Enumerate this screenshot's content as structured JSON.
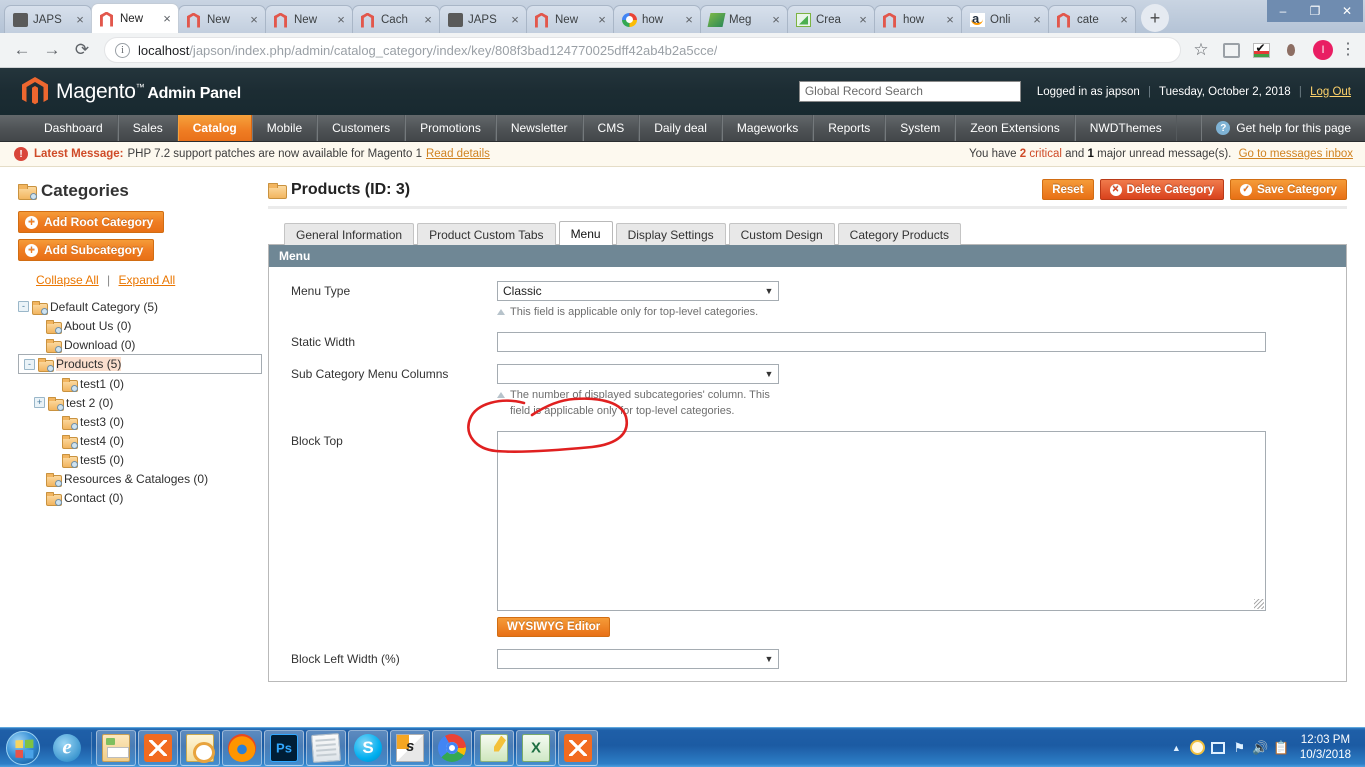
{
  "browser": {
    "tabs": [
      {
        "title": "JAPS",
        "favicon": "japs-icon",
        "active": false
      },
      {
        "title": "New",
        "favicon": "magento-icon",
        "active": true
      },
      {
        "title": "New",
        "favicon": "magento-icon",
        "active": false
      },
      {
        "title": "New",
        "favicon": "magento-icon",
        "active": false
      },
      {
        "title": "Cach",
        "favicon": "magento-icon",
        "active": false
      },
      {
        "title": "JAPS",
        "favicon": "japs-icon",
        "active": false
      },
      {
        "title": "New",
        "favicon": "magento-icon",
        "active": false
      },
      {
        "title": "how",
        "favicon": "google-icon",
        "active": false
      },
      {
        "title": "Meg",
        "favicon": "mega-icon",
        "active": false
      },
      {
        "title": "Crea",
        "favicon": "create-icon",
        "active": false
      },
      {
        "title": "how",
        "favicon": "magento-icon",
        "active": false
      },
      {
        "title": "Onli",
        "favicon": "amazon-icon",
        "active": false
      },
      {
        "title": "cate",
        "favicon": "magento-icon",
        "active": false
      }
    ],
    "new_tab_label": "+",
    "close_label": "×",
    "window_controls": {
      "minimize": "–",
      "maximize": "❐",
      "close": "✕"
    },
    "nav": {
      "back": "←",
      "forward": "→",
      "reload": "⟳"
    },
    "omnibox": {
      "info_icon": "i",
      "url_host": "localhost",
      "url_path": "/japson/index.php/admin/catalog_category/index/key/808f3bad124770025dff42ab4b2a5cce/"
    },
    "toolbar_right": {
      "bookmark_icon": "☆",
      "avatar_letter": "I",
      "menu_icon": "⋮"
    }
  },
  "magento": {
    "logo_text": "Magento",
    "logo_tm": "™",
    "logo_suffix": "Admin Panel",
    "search_placeholder": "Global Record Search",
    "logged_in_as": "Logged in as japson",
    "date": "Tuesday, October 2, 2018",
    "logout": "Log Out",
    "nav_items": [
      {
        "label": "Dashboard",
        "active": false
      },
      {
        "label": "Sales",
        "active": false
      },
      {
        "label": "Catalog",
        "active": true
      },
      {
        "label": "Mobile",
        "active": false
      },
      {
        "label": "Customers",
        "active": false
      },
      {
        "label": "Promotions",
        "active": false
      },
      {
        "label": "Newsletter",
        "active": false
      },
      {
        "label": "CMS",
        "active": false
      },
      {
        "label": "Daily deal",
        "active": false
      },
      {
        "label": "Mageworks",
        "active": false
      },
      {
        "label": "Reports",
        "active": false
      },
      {
        "label": "System",
        "active": false
      },
      {
        "label": "Zeon Extensions",
        "active": false
      },
      {
        "label": "NWDThemes",
        "active": false
      }
    ],
    "help_label": "Get help for this page",
    "help_icon_char": "?",
    "message_bar": {
      "icon_char": "!",
      "label": "Latest Message:",
      "text": "PHP 7.2 support patches are now available for Magento 1",
      "link": "Read details",
      "right_prefix": "You have",
      "right_critical_count": "2",
      "right_critical_word": "critical",
      "right_mid": "and",
      "right_major_count": "1",
      "right_suffix": "major unread message(s).",
      "right_link": "Go to messages inbox"
    }
  },
  "sidebar": {
    "title": "Categories",
    "add_root_label": "Add Root Category",
    "add_sub_label": "Add Subcategory",
    "plus_char": "+",
    "collapse_all": "Collapse All",
    "expand_all": "Expand All",
    "separator": "|",
    "tree": [
      {
        "label": "Default Category (5)",
        "level": 0,
        "toggle": "-",
        "selected": false
      },
      {
        "label": "About Us (0)",
        "level": 1,
        "toggle": "",
        "selected": false
      },
      {
        "label": "Download (0)",
        "level": 1,
        "toggle": "",
        "selected": false
      },
      {
        "label": "Products (5)",
        "level": 1,
        "toggle": "-",
        "selected": true
      },
      {
        "label": "test1 (0)",
        "level": 2,
        "toggle": "",
        "selected": false
      },
      {
        "label": "test 2 (0)",
        "level": 2,
        "toggle": "+",
        "selected": false
      },
      {
        "label": "test3 (0)",
        "level": 2,
        "toggle": "",
        "selected": false
      },
      {
        "label": "test4 (0)",
        "level": 2,
        "toggle": "",
        "selected": false
      },
      {
        "label": "test5 (0)",
        "level": 2,
        "toggle": "",
        "selected": false
      },
      {
        "label": "Resources & Cataloges (0)",
        "level": 1,
        "toggle": "",
        "selected": false
      },
      {
        "label": "Contact (0)",
        "level": 1,
        "toggle": "",
        "selected": false
      }
    ]
  },
  "content": {
    "page_title": "Products (ID: 3)",
    "buttons": {
      "reset": "Reset",
      "delete": "Delete Category",
      "save": "Save Category",
      "delete_icon_char": "✕",
      "save_icon_char": "✓"
    },
    "tabs": [
      {
        "label": "General Information",
        "active": false
      },
      {
        "label": "Product Custom Tabs",
        "active": false
      },
      {
        "label": "Menu",
        "active": true
      },
      {
        "label": "Display Settings",
        "active": false
      },
      {
        "label": "Custom Design",
        "active": false
      },
      {
        "label": "Category Products",
        "active": false
      }
    ],
    "panel_title": "Menu",
    "fields": {
      "menu_type": {
        "label": "Menu Type",
        "value": "Classic",
        "hint": "This field is applicable only for top-level categories."
      },
      "static_width": {
        "label": "Static Width",
        "value": ""
      },
      "sub_category_menu_columns": {
        "label": "Sub Category Menu Columns",
        "value": "",
        "hint": "The number of displayed subcategories' column. This field is applicable only for top-level categories."
      },
      "block_top": {
        "label": "Block Top",
        "value": "",
        "editor_button": "WYSIWYG Editor"
      },
      "block_left_width": {
        "label": "Block Left Width (%)",
        "value": ""
      }
    },
    "dropdown_arrow": "▼",
    "annotation": {
      "shape": "red-ellipse",
      "color": "#e02020",
      "target": "Menu Type dropdown"
    }
  },
  "taskbar": {
    "start_label": "Start",
    "apps": [
      {
        "name": "internet-explorer",
        "pinned": true
      },
      {
        "name": "file-explorer",
        "pinned": true
      },
      {
        "name": "xampp",
        "pinned": true
      },
      {
        "name": "outlook",
        "pinned": true
      },
      {
        "name": "firefox",
        "pinned": true
      },
      {
        "name": "photoshop",
        "pinned": true
      },
      {
        "name": "notepad",
        "pinned": true
      },
      {
        "name": "skype",
        "pinned": true
      },
      {
        "name": "sublime-text",
        "pinned": true
      },
      {
        "name": "chrome",
        "pinned": true
      },
      {
        "name": "notepad-plus",
        "pinned": true
      },
      {
        "name": "excel",
        "pinned": true
      },
      {
        "name": "xampp-control",
        "pinned": true
      }
    ],
    "tray": {
      "show_hidden": "▲",
      "icons": [
        "clock-icon",
        "network-icon",
        "flag-icon",
        "volume-icon",
        "action-center-icon"
      ]
    },
    "time": "12:03 PM",
    "date": "10/3/2018"
  }
}
